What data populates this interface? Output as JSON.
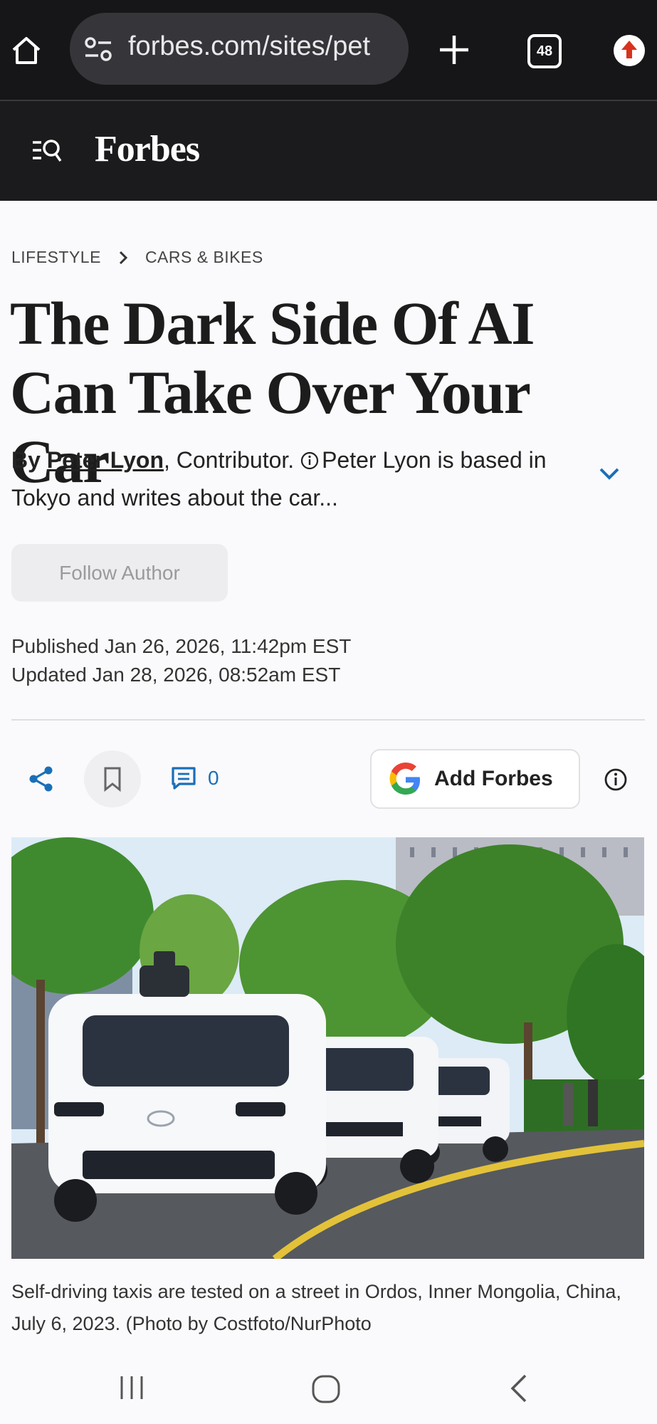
{
  "browser": {
    "url": "forbes.com/sites/pet",
    "tab_count": "48"
  },
  "site": {
    "logo_text": "Forbes"
  },
  "article": {
    "breadcrumb": [
      "LIFESTYLE",
      "CARS & BIKES"
    ],
    "headline": "The Dark Side Of AI Can Take Over Your Car",
    "byline": {
      "by": "By",
      "author": "Peter Lyon",
      "role": ", Contributor.",
      "bio": "Peter Lyon is based in Tokyo and writes about the car..."
    },
    "follow_label": "Follow Author",
    "published": "Published Jan 26, 2026, 11:42pm EST",
    "updated": "Updated Jan 28, 2026, 08:52am EST",
    "comment_count": "0",
    "add_forbes_label": "Add Forbes",
    "caption": "Self-driving taxis are tested on a street in Ordos, Inner Mongolia, China, July 6, 2023. (Photo by Costfoto/NurPhoto"
  },
  "icons": {
    "home": "home-icon",
    "url_settings": "tune-icon",
    "new_tab": "plus-icon",
    "tabs": "tab-switcher-icon",
    "update": "arrow-up-circle-icon",
    "menu_search": "menu-search-icon",
    "share": "share-icon",
    "bookmark": "bookmark-icon",
    "comment": "comment-icon",
    "google": "google-logo-icon",
    "info": "info-icon"
  },
  "colors": {
    "accent_blue": "#1a6fb8",
    "header_bg": "#1b1b1d",
    "browser_bg": "#161618",
    "update_red": "#d8321e"
  }
}
